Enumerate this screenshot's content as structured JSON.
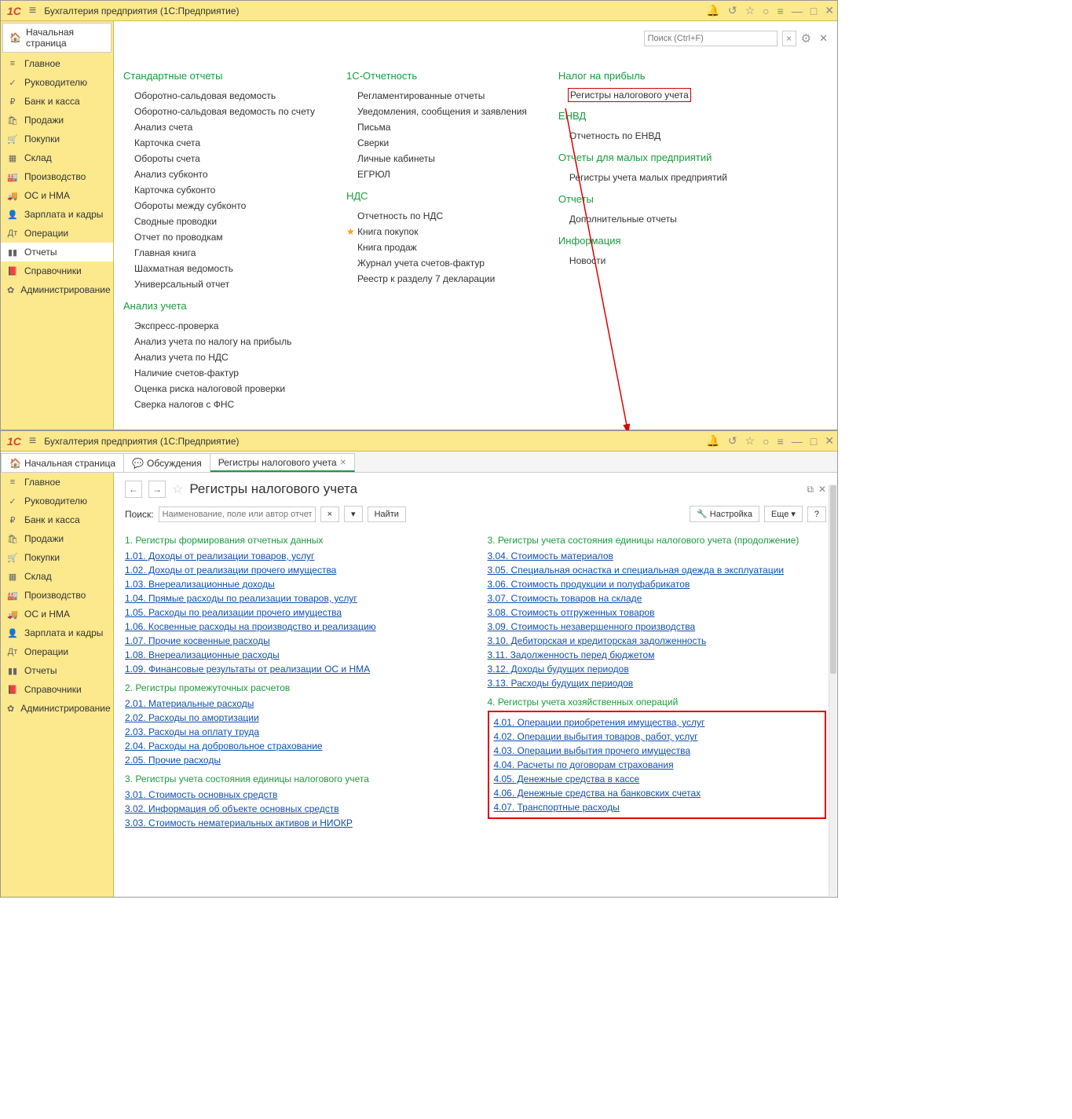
{
  "title": "Бухгалтерия предприятия  (1С:Предприятие)",
  "home": "Начальная страница",
  "searchPlaceholder": "Поиск (Ctrl+F)",
  "sidebar": [
    {
      "icon": "≡",
      "label": "Главное"
    },
    {
      "icon": "✓",
      "label": "Руководителю"
    },
    {
      "icon": "₽",
      "label": "Банк и касса"
    },
    {
      "icon": "🛍",
      "label": "Продажи"
    },
    {
      "icon": "🛒",
      "label": "Покупки"
    },
    {
      "icon": "▦",
      "label": "Склад"
    },
    {
      "icon": "🏭",
      "label": "Производство"
    },
    {
      "icon": "🚚",
      "label": "ОС и НМА"
    },
    {
      "icon": "👤",
      "label": "Зарплата и кадры"
    },
    {
      "icon": "Дт",
      "label": "Операции"
    },
    {
      "icon": "▮▮",
      "label": "Отчеты"
    },
    {
      "icon": "📕",
      "label": "Справочники"
    },
    {
      "icon": "✿",
      "label": "Администрирование"
    }
  ],
  "activeSidebar1": 10,
  "activeSidebar2": -1,
  "sections1": {
    "col1": [
      {
        "head": "Стандартные отчеты",
        "items": [
          "Оборотно-сальдовая ведомость",
          "Оборотно-сальдовая ведомость по счету",
          "Анализ счета",
          "Карточка счета",
          "Обороты счета",
          "Анализ субконто",
          "Карточка субконто",
          "Обороты между субконто",
          "Сводные проводки",
          "Отчет по проводкам",
          "Главная книга",
          "Шахматная ведомость",
          "Универсальный отчет"
        ]
      },
      {
        "head": "Анализ учета",
        "items": [
          "Экспресс-проверка",
          "Анализ учета по налогу на прибыль",
          "Анализ учета по НДС",
          "Наличие счетов-фактур",
          "Оценка риска налоговой проверки",
          "Сверка налогов с ФНС"
        ]
      }
    ],
    "col2": [
      {
        "head": "1С-Отчетность",
        "items": [
          "Регламентированные отчеты",
          "Уведомления, сообщения и заявления",
          "Письма",
          "Сверки",
          "Личные кабинеты",
          "ЕГРЮЛ"
        ]
      },
      {
        "head": "НДС",
        "items": [
          "Отчетность по НДС",
          {
            "text": "Книга покупок",
            "star": true
          },
          "Книга продаж",
          "Журнал учета счетов-фактур",
          "Реестр к разделу 7 декларации"
        ]
      }
    ],
    "col3": [
      {
        "head": "Налог на прибыль",
        "items": [
          {
            "text": "Регистры налогового учета",
            "boxed": true
          }
        ]
      },
      {
        "head": "ЕНВД",
        "items": [
          "Отчетность по ЕНВД"
        ]
      },
      {
        "head": "Отчеты для малых предприятий",
        "items": [
          "Регистры учета малых предприятий"
        ]
      },
      {
        "head": "Отчеты",
        "items": [
          "Дополнительные отчеты"
        ]
      },
      {
        "head": "Информация",
        "items": [
          "Новости"
        ]
      }
    ]
  },
  "tabs": [
    {
      "icon": "🏠",
      "label": "Начальная страница"
    },
    {
      "icon": "💬",
      "label": "Обсуждения"
    },
    {
      "icon": "",
      "label": "Регистры налогового учета",
      "close": true,
      "active": true
    }
  ],
  "pageTitle": "Регистры налогового учета",
  "searchLabel": "Поиск:",
  "searchField": "Наименование, поле или автор отчета",
  "findBtn": "Найти",
  "settingsBtn": "Настройка",
  "moreBtn": "Еще",
  "registers": {
    "left": [
      {
        "head": "1. Регистры формирования отчетных данных",
        "items": [
          "1.01. Доходы от реализации товаров, услуг",
          "1.02. Доходы от реализации прочего имущества",
          "1.03. Внереализационные доходы",
          "1.04. Прямые расходы по реализации товаров, услуг",
          "1.05. Расходы по реализации прочего имущества",
          "1.06. Косвенные расходы на производство и реализацию",
          "1.07. Прочие косвенные расходы",
          "1.08. Внереализационные расходы",
          "1.09. Финансовые результаты от реализации ОС и НМА"
        ]
      },
      {
        "head": "2. Регистры промежуточных расчетов",
        "items": [
          "2.01. Материальные расходы",
          "2.02. Расходы по амортизации",
          "2.03. Расходы на оплату труда",
          "2.04. Расходы на добровольное страхование",
          "2.05. Прочие расходы"
        ]
      },
      {
        "head": "3. Регистры учета состояния единицы налогового учета",
        "items": [
          "3.01. Стоимость основных средств",
          "3.02. Информация об объекте основных средств",
          "3.03. Стоимость нематериальных активов и НИОКР"
        ]
      }
    ],
    "right": [
      {
        "head": "3. Регистры учета состояния единицы налогового учета (продолжение)",
        "items": [
          "3.04. Стоимость материалов",
          "3.05. Специальная оснастка и специальная одежда в эксплуатации",
          "3.06. Стоимость продукции и полуфабрикатов",
          "3.07. Стоимость товаров на складе",
          "3.08. Стоимость отгруженных товаров",
          "3.09. Стоимость незавершенного производства",
          "3.10. Дебиторская и кредиторская задолженность",
          "3.11. Задолженность перед бюджетом",
          "3.12. Доходы будущих периодов",
          "3.13. Расходы будущих периодов"
        ]
      },
      {
        "head": "4. Регистры учета хозяйственных операций",
        "boxed": true,
        "items": [
          "4.01. Операции приобретения имущества, услуг",
          "4.02. Операции выбытия товаров, работ, услуг",
          "4.03. Операции выбытия прочего имущества",
          "4.04. Расчеты по договорам страхования",
          "4.05. Денежные средства в кассе",
          "4.06. Денежные средства на банковских счетах",
          "4.07. Транспортные расходы"
        ]
      }
    ]
  }
}
